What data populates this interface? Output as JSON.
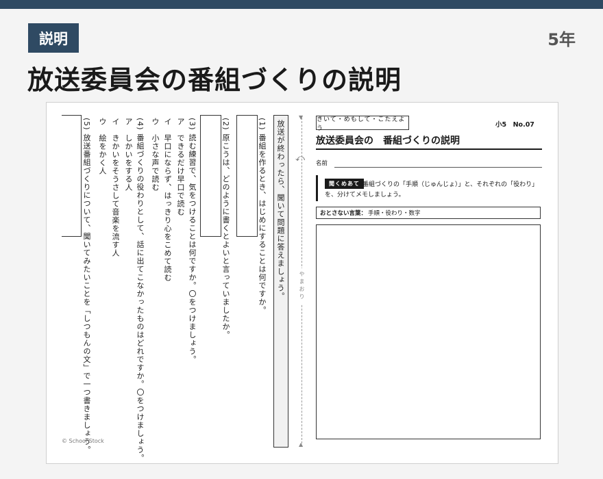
{
  "header": {
    "badge": "説明",
    "grade": "5年",
    "title": "放送委員会の番組づくりの説明"
  },
  "sheet": {
    "left": {
      "intro": "放送が終わったら、聞いて問題に答えましょう。",
      "q1": "(1) 番組を作るとき、はじめにすることは何ですか。",
      "q2": "(2) 原こうは、どのように書くとよいと言っていましたか。",
      "q3": "(3) 読む練習で、気をつけることは何ですか。〇をつけましょう。",
      "q3_options": [
        "ア　できるだけ早口で読む",
        "イ　早口にならず、はっきり心をこめて読む",
        "ウ　小さな声で読む"
      ],
      "q4": "(4) 番組づくりの役わりとして、話に出てこなかったものはどれですか。〇をつけましょう。",
      "q4_options": [
        "ア　しかいをする人",
        "イ　きかいをそうさして音楽を流す人",
        "ウ　絵をかく人"
      ],
      "q5": "(5) 放送番組づくりについて、聞いてみたいことを「しつもんの文」で一つ書きましょう。",
      "fold_label": "やまおり",
      "fold_arrow_top": "▼",
      "fold_arrow_bottom": "▲",
      "copyright": "© School Stock"
    },
    "right": {
      "category": "きいて・めもして・こたえよう",
      "sheet_no": "小5　No.07",
      "title": "放送委員会の　番組づくりの説明",
      "name_label": "名前",
      "instr_tag": "聞くめあて",
      "instr_line1": "番組づくりの「手順（じゅんじょ）」と、それぞれの「役わり」",
      "instr_line2": "を、分けてメモしましょう。",
      "otona_label": "おとさない言葉：",
      "otona_words": "手順・役わり・数字"
    }
  }
}
